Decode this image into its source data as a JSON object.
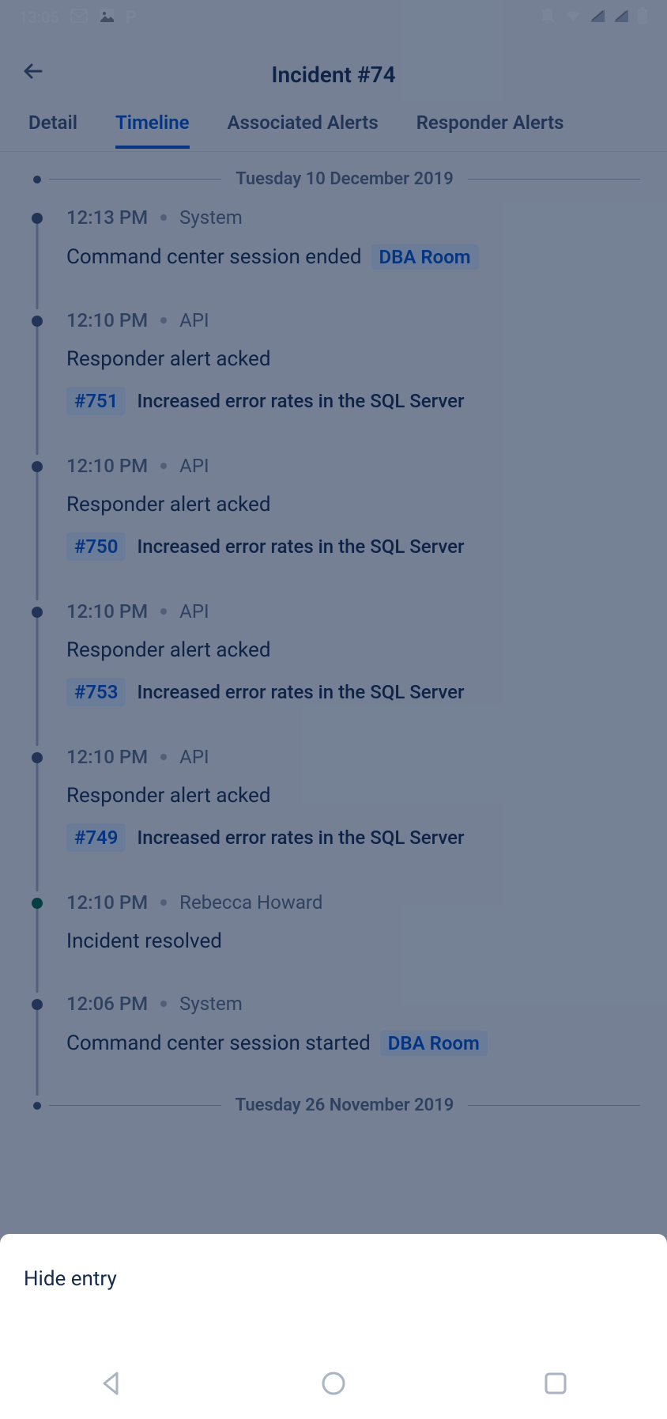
{
  "statusBar": {
    "time": "13:05"
  },
  "header": {
    "title": "Incident #74"
  },
  "tabs": [
    {
      "label": "Detail",
      "active": false
    },
    {
      "label": "Timeline",
      "active": true
    },
    {
      "label": "Associated Alerts",
      "active": false
    },
    {
      "label": "Responder Alerts",
      "active": false
    }
  ],
  "timeline": {
    "date1": "Tuesday 10 December 2019",
    "date2": "Tuesday 26 November 2019",
    "items": [
      {
        "time": "12:13 PM",
        "actor": "System",
        "desc": "Command center session ended",
        "tag": "DBA Room",
        "dotColor": "grey"
      },
      {
        "time": "12:10 PM",
        "actor": "API",
        "desc": "Responder alert acked",
        "alertId": "#751",
        "alertText": "Increased error rates in the SQL Server",
        "dotColor": "grey"
      },
      {
        "time": "12:10 PM",
        "actor": "API",
        "desc": "Responder alert acked",
        "alertId": "#750",
        "alertText": "Increased error rates in the SQL Server",
        "dotColor": "grey"
      },
      {
        "time": "12:10 PM",
        "actor": "API",
        "desc": "Responder alert acked",
        "alertId": "#753",
        "alertText": "Increased error rates in the SQL Server",
        "dotColor": "grey"
      },
      {
        "time": "12:10 PM",
        "actor": "API",
        "desc": "Responder alert acked",
        "alertId": "#749",
        "alertText": "Increased error rates in the SQL Server",
        "dotColor": "grey"
      },
      {
        "time": "12:10 PM",
        "actor": "Rebecca Howard",
        "desc": "Incident resolved",
        "dotColor": "green"
      },
      {
        "time": "12:06 PM",
        "actor": "System",
        "desc": "Command center session started",
        "tag": "DBA Room",
        "dotColor": "grey"
      }
    ]
  },
  "bottomSheet": {
    "hideEntry": "Hide entry"
  }
}
